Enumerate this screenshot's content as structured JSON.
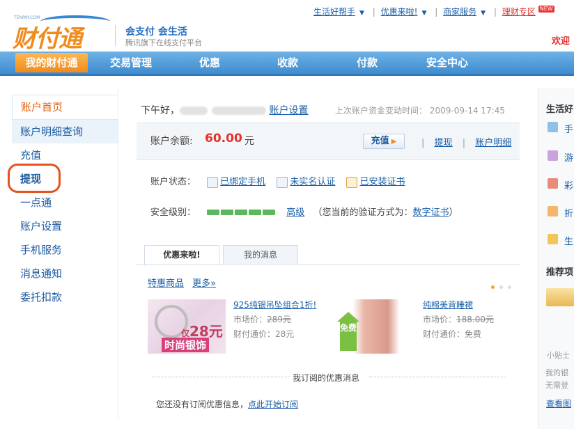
{
  "logo": {
    "en": "TENPAY.COM",
    "cn": "财付通",
    "slogan": "会支付 会生活",
    "subslogan": "腾讯旗下在线支付平台"
  },
  "toplinks": {
    "help": "生活好帮手",
    "promo": "优惠来啦!",
    "merchant": "商家服务",
    "finance": "理财专区",
    "new_badge": "NEW"
  },
  "welcome": "欢迎",
  "nav": [
    "我的财付通",
    "交易管理",
    "优惠",
    "收款",
    "付款",
    "安全中心"
  ],
  "sidebar": [
    "账户首页",
    "账户明细查询",
    "充值",
    "提现",
    "一点通",
    "账户设置",
    "手机服务",
    "消息通知",
    "委托扣款"
  ],
  "account": {
    "greeting": "下午好，",
    "settings_link": "账户设置",
    "last_change_label": "上次账户资金变动时间：",
    "last_change_time": "2009-09-14 17:45",
    "balance_label": "账户余额:",
    "balance_value": "60.00",
    "balance_unit": "元",
    "recharge": "充值",
    "withdraw": "提现",
    "details": "账户明细",
    "status_label": "账户状态：",
    "status_phone": "已绑定手机",
    "status_realname": "未实名认证",
    "status_cert": "已安装证书",
    "security_label": "安全级别：",
    "security_level": "高级",
    "verify_prefix": "（您当前的验证方式为：",
    "verify_method": "数字证书",
    "verify_suffix": "）",
    "security_bars": 5
  },
  "tabs": [
    "优惠来啦!",
    "我的消息"
  ],
  "promo": {
    "specials": "特惠商品",
    "more": "更多»"
  },
  "products": [
    {
      "title": "925纯银吊坠组合1折!",
      "market": "市场价：",
      "market_price": "289元",
      "price": "财付通价：28元",
      "img_price": "28元",
      "img_prefix": "仅",
      "img_tag": "时尚银饰"
    },
    {
      "title": "纯棉美背睡裙",
      "market": "市场价：",
      "market_price": "188.00元",
      "price": "财付通价：免费",
      "img_tag": "免费"
    }
  ],
  "subscription": {
    "title": "我订阅的优惠消息",
    "msg": "您还没有订阅优惠信息，",
    "link": "点此开始订阅"
  },
  "right": {
    "title1": "生活好",
    "items": [
      "手",
      "游",
      "彩",
      "折",
      "生"
    ],
    "title2": "推荐项",
    "tip1": "小贴士",
    "tip2": "我的银",
    "tip3": "无需登",
    "more": "查看图"
  },
  "colors": {
    "nav_blue": "#4f9bd9",
    "nav_active": "#f39a2a",
    "balance_red": "#e4322b",
    "link": "#1a5fa8",
    "highlight_circle": "#e5521b"
  }
}
